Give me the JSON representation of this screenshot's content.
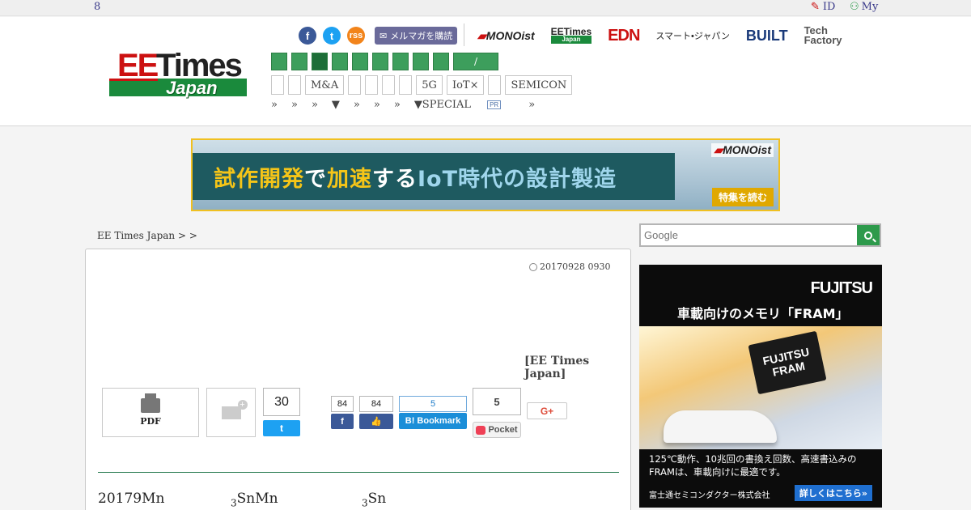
{
  "topbar": {
    "number": "8",
    "id_label": "ID",
    "my_label": "My"
  },
  "header": {
    "logo": {
      "ee": "EE",
      "times": "Times",
      "japan": "Japan"
    },
    "social": {
      "fb": "f",
      "tw": "t",
      "rss": "rss",
      "mail_label": "メルマガを購読"
    },
    "partners": {
      "mono": "MONOist",
      "eetimes": "EETimes",
      "eetimes_sub": "Japan",
      "edn": "EDN",
      "smart": "スマート•ジャパン",
      "built": "BUILT",
      "tech": "Tech",
      "factory": "Factory"
    },
    "green_nav_last": "/",
    "tags": [
      "",
      "",
      "M&A",
      "",
      "",
      "",
      "",
      "5G",
      "IoT×",
      "",
      "SEMICON"
    ],
    "subnav": [
      "»",
      "»",
      "»",
      "▼",
      "»",
      "»",
      "»",
      "▼SPECIAL",
      "»"
    ],
    "pr_badge": "PR"
  },
  "banner": {
    "copy_1": "試作開発",
    "copy_2": "で",
    "copy_3": "加速",
    "copy_4": "する",
    "copy_5": "IoT時代の設計製造",
    "brand": "MONOist",
    "cta": "特集を読む"
  },
  "breadcrumb": "EE Times Japan >  >",
  "article": {
    "date": "20170928 0930",
    "byline": "[EE Times Japan]",
    "pdf_label": "PDF",
    "tw_count": "30",
    "tw_btn": "t",
    "fb_count": "84",
    "fb_btn": "f",
    "like_count": "84",
    "like_btn": "👍",
    "hatena_count": "5",
    "hatena_btn": "B! Bookmark",
    "pocket_count": "5",
    "pocket_btn": "Pocket",
    "gplus_btn": "G+",
    "formula_1": "20179Mn",
    "formula_2_sub": "3",
    "formula_2": "SnMn",
    "formula_3_sub": "3",
    "formula_3": "Sn"
  },
  "search": {
    "placeholder": "Google"
  },
  "sidead": {
    "brand": "FUJITSU",
    "headline": "車載向けのメモリ「FRAM」",
    "chip_1": "FUJITSU",
    "chip_2": "FRAM",
    "body_1": "125℃動作、10兆回の書換え回数、高速書込みの",
    "body_2": "FRAMは、車載向けに最適です。",
    "company": "富士通セミコンダクター株式会社",
    "detail": "詳しくはこちら»"
  }
}
